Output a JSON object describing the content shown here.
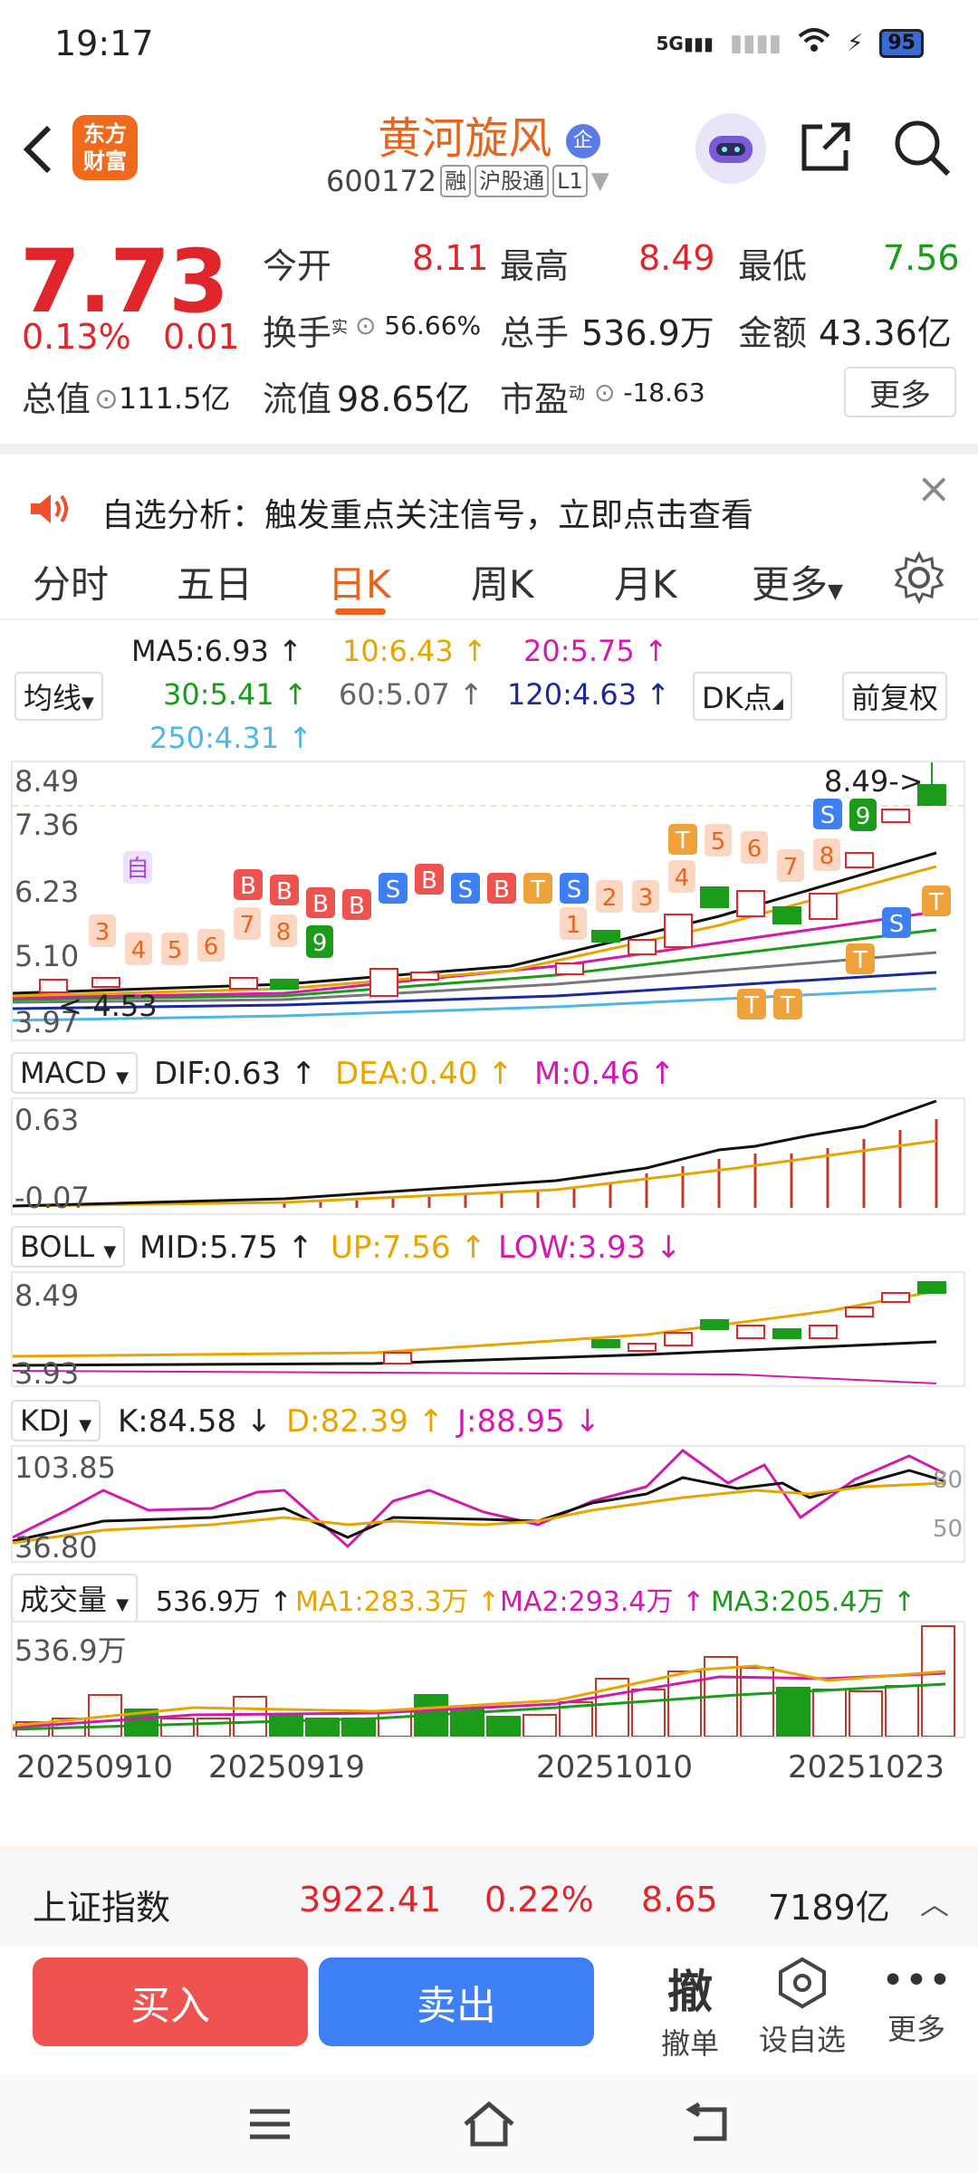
{
  "status_bar": {
    "time": "19:17",
    "network": "5G",
    "battery": "95"
  },
  "header": {
    "logo_line1": "东方",
    "logo_line2": "财富",
    "title": "黄河旋风",
    "title_badge": "企",
    "code": "600172",
    "tags": [
      "融",
      "沪股通",
      "L1"
    ]
  },
  "quote": {
    "price": "7.73",
    "change_pct": "0.13%",
    "change": "0.01",
    "open_label": "今开",
    "open": "8.11",
    "high_label": "最高",
    "high": "8.49",
    "low_label": "最低",
    "low": "7.56",
    "turnover_label": "换手",
    "turnover_sup": "实",
    "turnover": "56.66%",
    "volume_label": "总手",
    "volume": "536.9万",
    "amount_label": "金额",
    "amount": "43.36亿",
    "mktcap_label": "总值",
    "mktcap": "111.5亿",
    "float_label": "流值",
    "float": "98.65亿",
    "pe_label": "市盈",
    "pe_sup": "动",
    "pe": "-18.63",
    "more_button": "更多"
  },
  "banner": {
    "text": "自选分析：触发重点关注信号，立即点击查看"
  },
  "tabs": [
    {
      "label": "分时"
    },
    {
      "label": "五日"
    },
    {
      "label": "日K"
    },
    {
      "label": "周K"
    },
    {
      "label": "月K"
    },
    {
      "label": "更多"
    }
  ],
  "ma": {
    "ma5": "MA5:6.93 ↑",
    "ma10": "10:6.43 ↑",
    "ma20": "20:5.75 ↑",
    "ma30": "30:5.41 ↑",
    "ma60": "60:5.07 ↑",
    "ma120": "120:4.63 ↑",
    "ma250": "250:4.31 ↑",
    "dropdown": "均线",
    "dk_button": "DK点",
    "fq_button": "前复权"
  },
  "kline": {
    "y_labels": [
      "8.49",
      "7.36",
      "6.23",
      "5.10",
      "3.97"
    ],
    "high_note": "8.49->",
    "low_note": "<-4.53",
    "signal_tags": [
      "自",
      "3",
      "4",
      "5",
      "6",
      "B",
      "7",
      "B",
      "8",
      "B",
      "9",
      "B",
      "S",
      "B",
      "S",
      "B",
      "T",
      "S",
      "1",
      "2",
      "3",
      "T",
      "4",
      "5",
      "6",
      "7",
      "S",
      "8",
      "9",
      "S",
      "T",
      "T",
      "T",
      "T"
    ]
  },
  "macd": {
    "dropdown": "MACD",
    "dif": "DIF:0.63 ↑",
    "dea": "DEA:0.40 ↑",
    "m": "M:0.46 ↑",
    "y_top": "0.63",
    "y_bottom": "-0.07"
  },
  "boll": {
    "dropdown": "BOLL",
    "mid": "MID:5.75 ↑",
    "up": "UP:7.56 ↑",
    "low": "LOW:3.93 ↓",
    "y_top": "8.49",
    "y_bottom": "3.93"
  },
  "kdj": {
    "dropdown": "KDJ",
    "k": "K:84.58 ↓",
    "d": "D:82.39 ↑",
    "j": "J:88.95 ↓",
    "y_top": "103.85",
    "y_bottom": "36.80",
    "ref_80": "80",
    "ref_50": "50"
  },
  "volume": {
    "dropdown": "成交量",
    "vol": "536.9万 ↑",
    "ma1": "MA1:283.3万 ↑",
    "ma2": "MA2:293.4万 ↑",
    "ma3": "MA3:205.4万 ↑",
    "y_top": "536.9万"
  },
  "dates": [
    "20250910",
    "20250919",
    "20251010",
    "20251023"
  ],
  "index_bar": {
    "name": "上证指数",
    "value": "3922.41",
    "pct": "0.22%",
    "change": "8.65",
    "amount": "7189亿"
  },
  "actions": {
    "buy": "买入",
    "sell": "卖出",
    "cancel_icon": "撤",
    "cancel": "撤单",
    "watch": "设自选",
    "more": "更多"
  },
  "colors": {
    "up": "#e0262b",
    "down": "#1a9b1a",
    "accent": "#e8641b",
    "buy": "#ef5350",
    "sell": "#3e7ff3"
  }
}
